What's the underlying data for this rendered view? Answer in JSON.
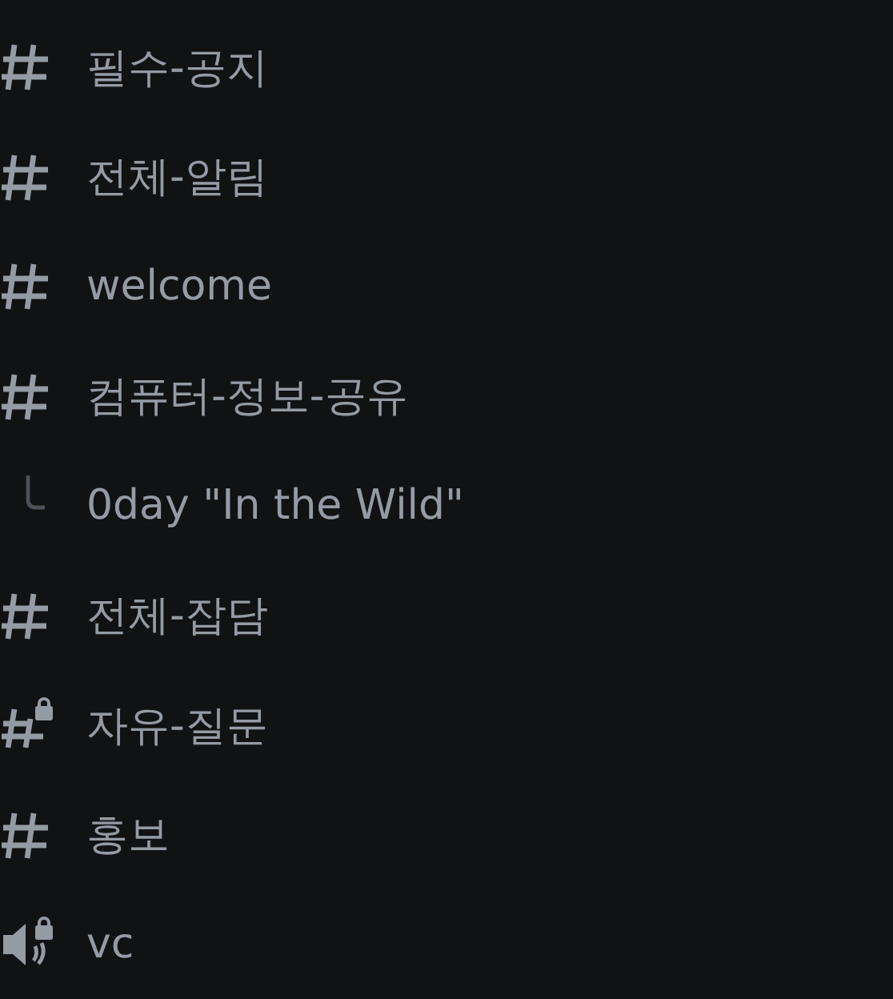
{
  "channels": [
    {
      "kind": "text",
      "name": "필수-공지"
    },
    {
      "kind": "text",
      "name": "전체-알림"
    },
    {
      "kind": "text",
      "name": "welcome"
    },
    {
      "kind": "text",
      "name": "컴퓨터-정보-공유"
    },
    {
      "kind": "thread",
      "name": "0day \"In the Wild\""
    },
    {
      "kind": "text",
      "name": "전체-잡담"
    },
    {
      "kind": "locked_text",
      "name": "자유-질문"
    },
    {
      "kind": "text",
      "name": "홍보"
    },
    {
      "kind": "locked_voice",
      "name": "vc"
    }
  ]
}
